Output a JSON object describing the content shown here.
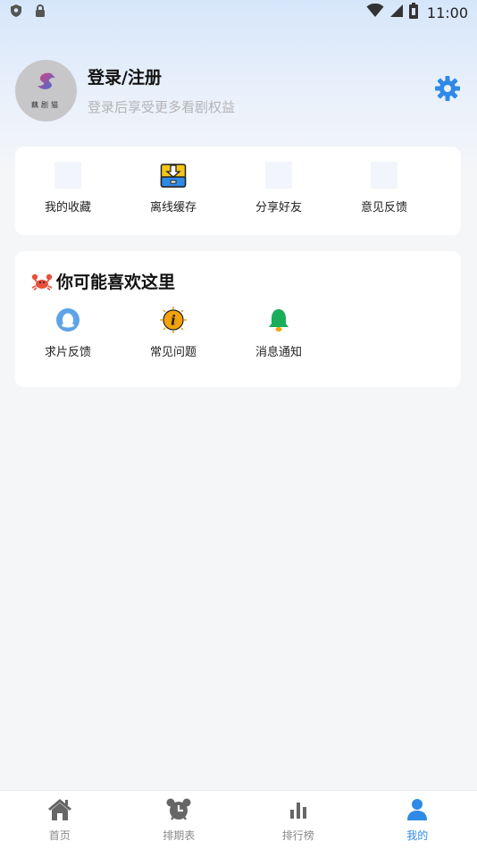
{
  "status_bar": {
    "time": "11:00",
    "icons": [
      "shield-icon",
      "lock-icon",
      "wifi-icon",
      "signal-icon",
      "battery-icon"
    ]
  },
  "profile": {
    "avatar_text": "藕剧猫",
    "title": "登录/注册",
    "subtitle": "登录后享受更多看剧权益",
    "settings_icon": "gear-icon"
  },
  "quick_actions": [
    {
      "label": "我的收藏",
      "icon": "favorites-icon"
    },
    {
      "label": "离线缓存",
      "icon": "download-folder-icon"
    },
    {
      "label": "分享好友",
      "icon": "share-icon"
    },
    {
      "label": "意见反馈",
      "icon": "feedback-icon"
    }
  ],
  "recommend": {
    "title": "你可能喜欢这里",
    "title_icon": "crab-icon",
    "items": [
      {
        "label": "求片反馈",
        "icon": "qq-penguin-icon"
      },
      {
        "label": "常见问题",
        "icon": "info-icon"
      },
      {
        "label": "消息通知",
        "icon": "bell-icon"
      }
    ]
  },
  "tabs": [
    {
      "label": "首页",
      "icon": "home-icon",
      "active": false
    },
    {
      "label": "排期表",
      "icon": "alarm-clock-icon",
      "active": false
    },
    {
      "label": "排行榜",
      "icon": "bar-chart-icon",
      "active": false
    },
    {
      "label": "我的",
      "icon": "person-icon",
      "active": true
    }
  ],
  "colors": {
    "accent": "#2e8ae6",
    "background": "#f5f6f8",
    "card": "#ffffff"
  }
}
